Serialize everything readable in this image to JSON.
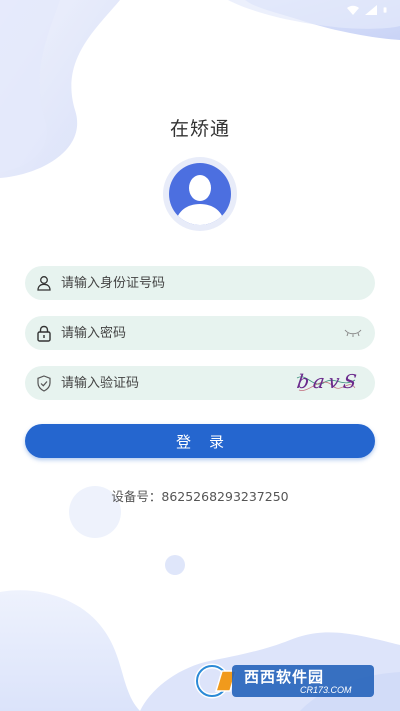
{
  "app": {
    "title": "在矫通"
  },
  "form": {
    "id_card_placeholder": "请输入身份证号码",
    "password_placeholder": "请输入密码",
    "captcha_placeholder": "请输入验证码",
    "captcha_text": "bavS",
    "login_label": "登录"
  },
  "device": {
    "label": "设备号：",
    "number": "8625268293237250"
  },
  "watermark": {
    "brand": "西西软件园",
    "domain": "CR173.COM"
  },
  "colors": {
    "primary_button": "#2566cf",
    "field_background": "#e7f3ef",
    "avatar_blue": "#4c6fe0",
    "blob_light": "#e6ebfb"
  },
  "icons": {
    "id_field": "user-icon",
    "password_field": "lock-icon",
    "captcha_field": "shield-icon",
    "password_toggle": "eye-closed-icon"
  }
}
